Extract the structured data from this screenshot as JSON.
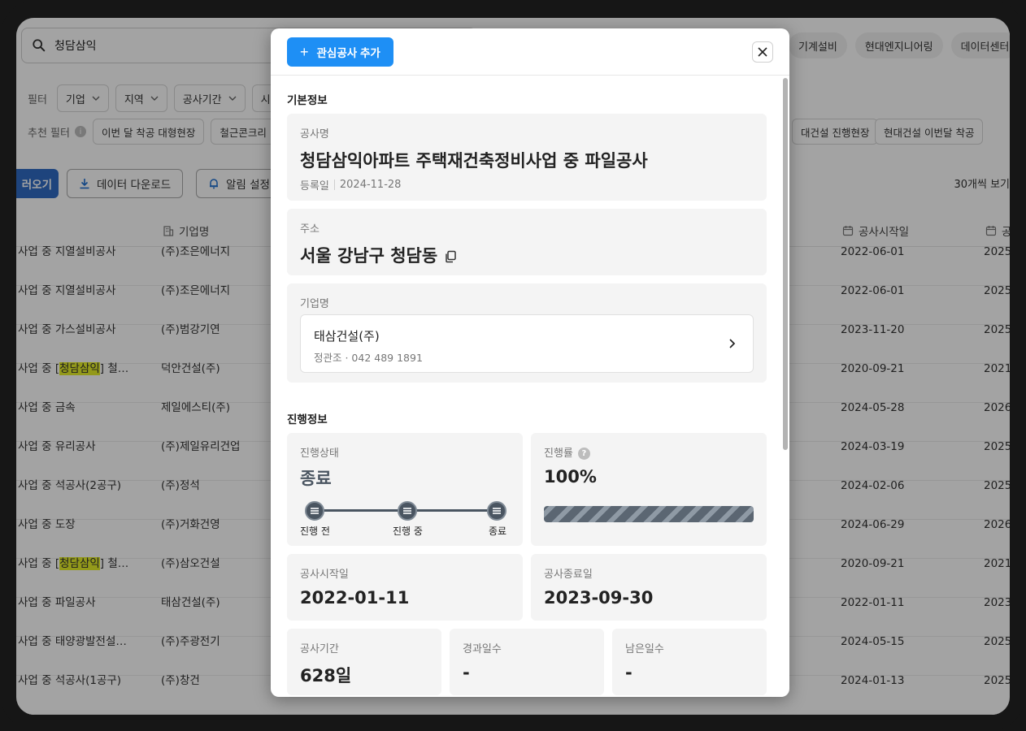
{
  "search": {
    "query": "청담삼익"
  },
  "quick_chips": [
    "기계설비",
    "현대엔지니어링",
    "데이터센터"
  ],
  "filters": {
    "label": "필터",
    "items": [
      "기업",
      "지역",
      "공사기간",
      "시"
    ]
  },
  "recommended": {
    "label": "추천 필터",
    "info": "i",
    "chips": [
      "이번 달 착공 대형현장",
      "철근콘크리"
    ],
    "right_chips": [
      "대건설 진행현장",
      "현대건설 이번달 착공"
    ]
  },
  "actions": {
    "primary": "러오기",
    "download": "데이터 다운로드",
    "alert": "알림 설정",
    "per_page": "30개씩 보기"
  },
  "table": {
    "headers": {
      "company": "기업명",
      "start": "공사시작일",
      "end": "공"
    },
    "rows": [
      {
        "pre": "사업 중 지열설비공사",
        "hl": "",
        "post": "",
        "company": "(주)조은에너지",
        "start": "2022-06-01",
        "end": "2025"
      },
      {
        "pre": "사업 중 지열설비공사",
        "hl": "",
        "post": "",
        "company": "(주)조은에너지",
        "start": "2022-06-01",
        "end": "2025"
      },
      {
        "pre": "사업 중 가스설비공사",
        "hl": "",
        "post": "",
        "company": "(주)범강기연",
        "start": "2023-11-20",
        "end": "2025"
      },
      {
        "pre": "사업 중 [",
        "hl": "청담삼익",
        "post": "] 철…",
        "company": "덕안건설(주)",
        "start": "2020-09-21",
        "end": "2021"
      },
      {
        "pre": "사업 중 금속",
        "hl": "",
        "post": "",
        "company": "제일에스티(주)",
        "start": "2024-05-28",
        "end": "2026"
      },
      {
        "pre": "사업 중 유리공사",
        "hl": "",
        "post": "",
        "company": "(주)제일유리건업",
        "start": "2024-03-19",
        "end": "2025"
      },
      {
        "pre": "사업 중 석공사(2공구)",
        "hl": "",
        "post": "",
        "company": "(주)정석",
        "start": "2024-02-06",
        "end": "2025"
      },
      {
        "pre": "사업 중 도장",
        "hl": "",
        "post": "",
        "company": "(주)거화건영",
        "start": "2024-06-29",
        "end": "2026"
      },
      {
        "pre": "사업 중 [",
        "hl": "청담삼익",
        "post": "] 철…",
        "company": "(주)삼오건설",
        "start": "2020-09-21",
        "end": "2021"
      },
      {
        "pre": "사업 중 파일공사",
        "hl": "",
        "post": "",
        "company": "태삼건설(주)",
        "start": "2022-01-11",
        "end": "2023"
      },
      {
        "pre": "사업 중 태양광발전설…",
        "hl": "",
        "post": "",
        "company": "(주)주광전기",
        "start": "2024-05-15",
        "end": "2025"
      },
      {
        "pre": "사업 중 석공사(1공구)",
        "hl": "",
        "post": "",
        "company": "(주)창건",
        "start": "2024-01-13",
        "end": "2025"
      }
    ]
  },
  "modal": {
    "add_button": "관심공사 추가",
    "basic": {
      "title": "기본정보",
      "project_caption": "공사명",
      "project_name": "청담삼익아파트 주택재건축정비사업 중 파일공사",
      "reg_label": "등록일",
      "reg_date": "2024-11-28",
      "address_caption": "주소",
      "address": "서울 강남구 청담동",
      "company_caption": "기업명",
      "company_name": "태삼건설(주)",
      "company_sub": "정관조 · 042 489 1891"
    },
    "progress": {
      "title": "진행정보",
      "status_caption": "진행상태",
      "status": "종료",
      "steps": [
        "진행 전",
        "진행 중",
        "종료"
      ],
      "rate_caption": "진행률",
      "rate_help": "?",
      "rate": "100%",
      "rate_value": 1.0,
      "start_caption": "공사시작일",
      "start": "2022-01-11",
      "end_caption": "공사종료일",
      "end": "2023-09-30",
      "period_caption": "공사기간",
      "period": "628일",
      "elapsed_caption": "경과일수",
      "elapsed": "-",
      "remain_caption": "남은일수",
      "remain": "-"
    }
  },
  "colors": {
    "accent": "#1e8ff5",
    "status": "#4a5561",
    "highlight": "#e6ef2a"
  }
}
